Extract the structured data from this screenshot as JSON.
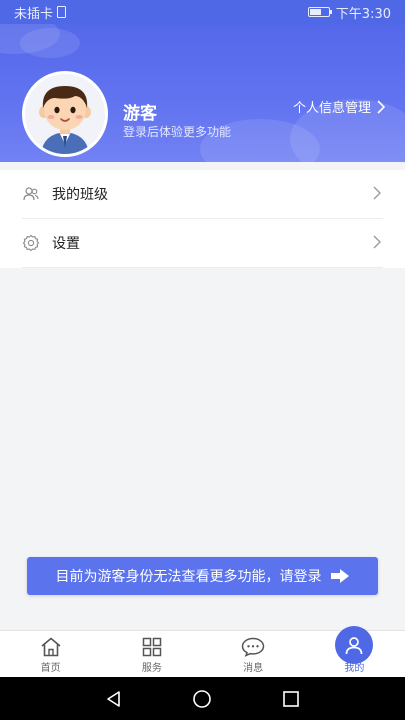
{
  "status_bar": {
    "carrier": "未插卡",
    "time": "下午3:30"
  },
  "profile": {
    "name": "游客",
    "subtitle": "登录后体验更多功能",
    "manage_link": "个人信息管理"
  },
  "menu": {
    "items": [
      {
        "label": "我的班级",
        "icon": "class-icon"
      },
      {
        "label": "设置",
        "icon": "gear-icon"
      }
    ]
  },
  "guest_banner": {
    "text": "目前为游客身份无法查看更多功能，请登录"
  },
  "tabbar": {
    "tabs": [
      {
        "label": "首页",
        "icon": "home-icon"
      },
      {
        "label": "服务",
        "icon": "grid-icon"
      },
      {
        "label": "消息",
        "icon": "chat-icon"
      },
      {
        "label": "我的",
        "icon": "person-icon",
        "active": true
      }
    ]
  },
  "colors": {
    "primary": "#4f68e6",
    "banner": "#5b74ee"
  }
}
